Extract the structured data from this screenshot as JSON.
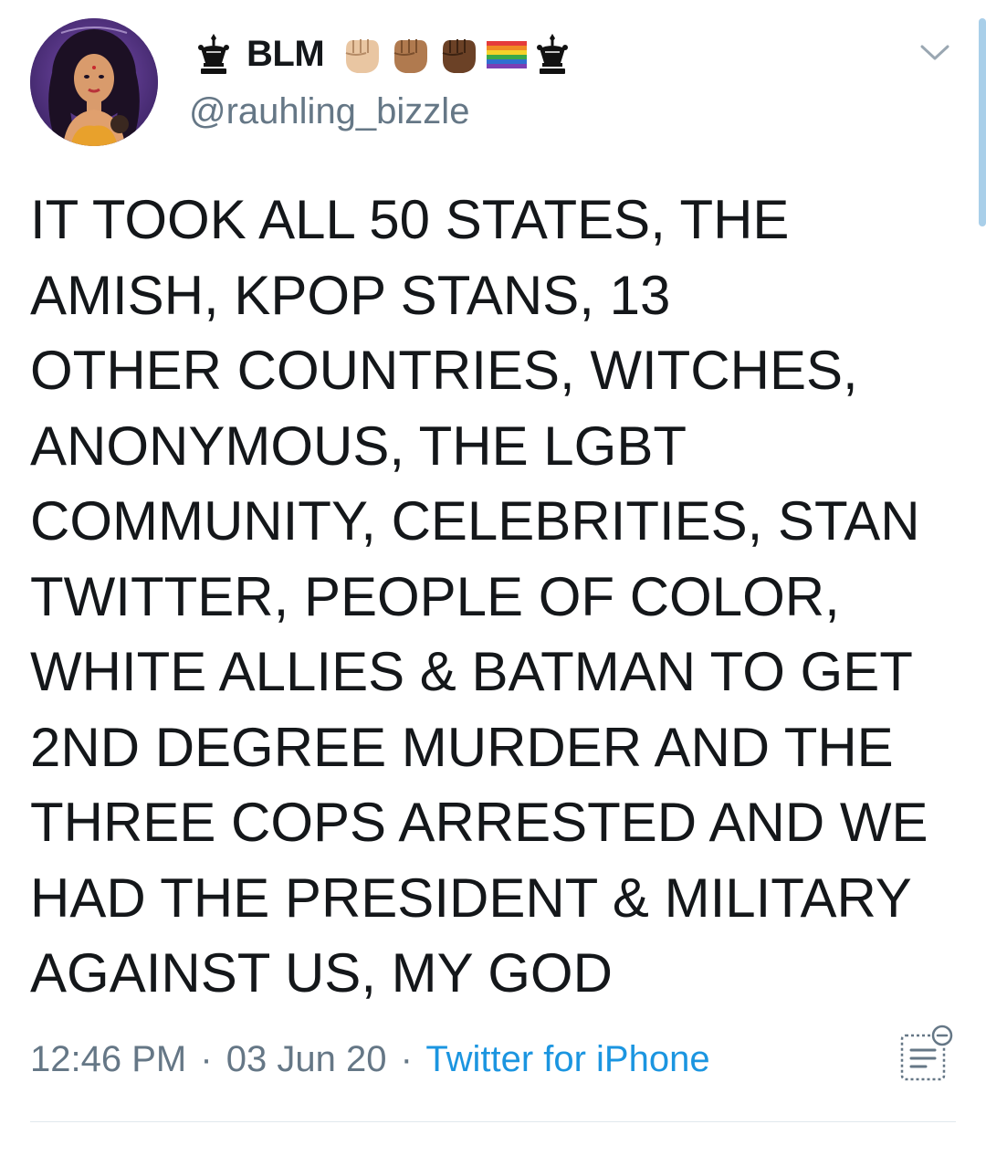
{
  "user": {
    "display_name": "BLM",
    "handle": "@rauhling_bizzle",
    "name_emojis": [
      "crown-icon",
      "raised-fist-light-icon",
      "raised-fist-medium-icon",
      "raised-fist-dark-icon",
      "rainbow-flag-icon",
      "crown-icon"
    ]
  },
  "tweet": {
    "lines": [
      "IT TOOK ALL 50 STATES, THE",
      "AMISH, KPOP STANS, 13",
      "OTHER COUNTRIES, WITCHES,",
      "ANONYMOUS, THE LGBT",
      "COMMUNITY, CELEBRITIES, STAN",
      "TWITTER, PEOPLE OF COLOR,",
      "WHITE ALLIES & BATMAN TO GET",
      "2ND DEGREE MURDER AND THE",
      "THREE COPS ARRESTED AND WE",
      "HAD THE PRESIDENT & MILITARY",
      "AGAINST US, MY GOD"
    ],
    "time": "12:46 PM",
    "separator": "·",
    "date": "03 Jun 20",
    "source": "Twitter for iPhone"
  },
  "colors": {
    "text": "#14171a",
    "secondary": "#657786",
    "link": "#1b95e0",
    "divider": "#e1e8ed"
  }
}
